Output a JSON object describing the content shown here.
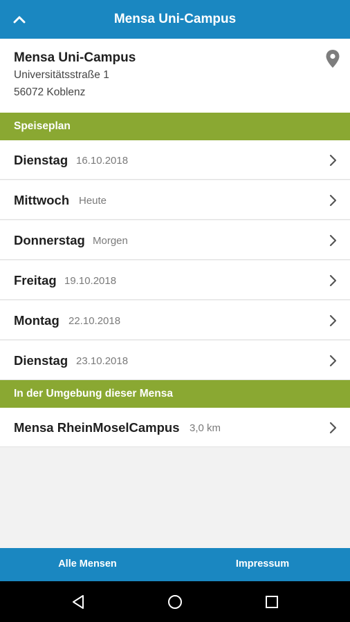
{
  "appbar": {
    "title": "Mensa Uni-Campus",
    "back_icon": "chevron-up-icon"
  },
  "location": {
    "name": "Mensa Uni-Campus",
    "street": "Universitätsstraße 1",
    "city": "56072 Koblenz",
    "map_icon": "map-pin-icon"
  },
  "sections": {
    "menu_title": "Speiseplan",
    "nearby_title": "In der Umgebung dieser Mensa"
  },
  "menu_days": [
    {
      "day": "Dienstag",
      "date": "16.10.2018"
    },
    {
      "day": "Mittwoch",
      "date": "Heute"
    },
    {
      "day": "Donnerstag",
      "date": "Morgen"
    },
    {
      "day": "Freitag",
      "date": "19.10.2018"
    },
    {
      "day": "Montag",
      "date": "22.10.2018"
    },
    {
      "day": "Dienstag",
      "date": "23.10.2018"
    }
  ],
  "nearby": [
    {
      "name": "Mensa RheinMoselCampus",
      "distance": "3,0 km"
    }
  ],
  "bottombar": {
    "all_label": "Alle Mensen",
    "imprint_label": "Impressum"
  },
  "colors": {
    "primary": "#1a87c1",
    "section": "#8aa832",
    "navbar": "#000000"
  }
}
